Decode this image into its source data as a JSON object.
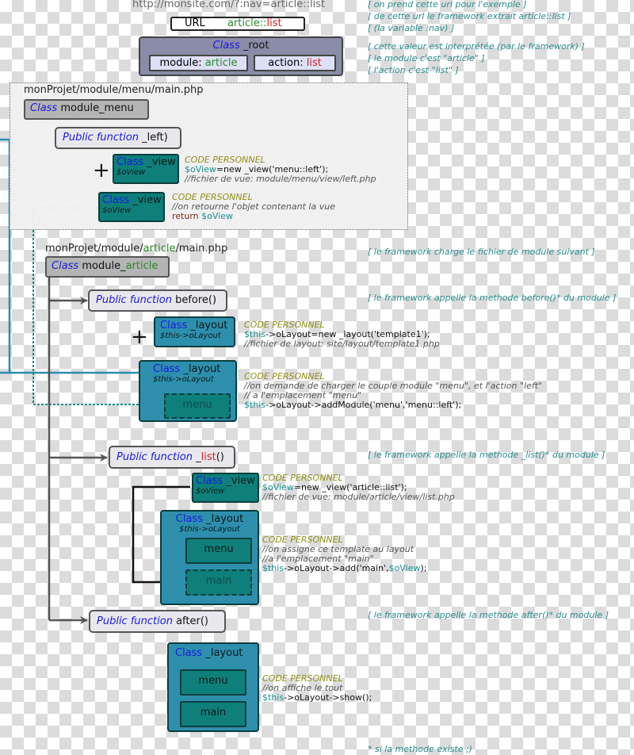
{
  "top": {
    "url_caption": "http://monsite.com/?:nav=article::list",
    "url_label": "URL",
    "url_value_module": "article",
    "url_value_sep": "::",
    "url_value_action": "list"
  },
  "root": {
    "class_kw": "Class",
    "class_name": "_root",
    "module_label": "module: ",
    "module_value": "article",
    "action_label": "action: ",
    "action_value": "list"
  },
  "notes": {
    "n1": "[ on prend cette url pour l'exemple ]",
    "n2": "[ de cette url le framework extrait article::list ]",
    "n3": "[ (la variable :nav) ]",
    "n4": "[ cette valeur est interprétée (par le framework) ]",
    "n5": "[ le module c'est \"article\" ]",
    "n6": "[ l'action c'est \"list\" ]",
    "n7": "[ le framework charge le fichier de module suivant ]",
    "n8": "[ le framework appelle la methode before()* du module ]",
    "n9": "[ le framework appelle la methode _list()* du module ]",
    "n10": "[ le framework appelle la methode after()* du module ]",
    "footnote": "* si la methode existe ;)"
  },
  "menu_module": {
    "path": "monProjet/module/menu/main.php",
    "class_kw": "Class",
    "class_name": "module_menu",
    "fn_kw": "Public function",
    "fn_name": "_left)",
    "view1": {
      "kw": "Class",
      "name": "_view",
      "var": "$oView"
    },
    "code1": {
      "title": "CODE PERSONNEL",
      "line1_var": "$oView",
      "line1_rest": "=new _view('menu::left');",
      "line2": "//fichier de vue: module/menu/view/left.php"
    },
    "view2": {
      "kw": "Class",
      "name": "_view",
      "var": "$oView"
    },
    "code2": {
      "title": "CODE PERSONNEL",
      "line1": "//on retourne l'objet contenant la vue",
      "line2_kw": "return ",
      "line2_var": "$oView"
    }
  },
  "article_module": {
    "path_a": "monProjet/module/",
    "path_b": "article",
    "path_c": "/main.php",
    "class_kw": "Class",
    "class_name_a": "module_",
    "class_name_b": "article",
    "before": {
      "fn_kw": "Public function",
      "fn_name": "before()",
      "layout1": {
        "kw": "Class",
        "name": "_layout",
        "var": "$this->oLayout"
      },
      "code1": {
        "title": "CODE PERSONNEL",
        "var": "$this",
        "rest": "->oLayout=new _layout('template1');",
        "comment": "//fichier de layout: site/layout/template1.php"
      },
      "layout2": {
        "kw": "Class",
        "name": "_layout",
        "var": "$this->oLayout",
        "slot": "menu"
      },
      "code2": {
        "title": "CODE PERSONNEL",
        "comment1": "//on demande de charger le couple module \"menu\", et l'action \"left\"",
        "comment2": "// a l'emplacement \"menu\"",
        "var": "$this",
        "rest": "->oLayout->addModule('menu','menu::left');"
      }
    },
    "list": {
      "fn_kw": "Public function",
      "fn_name_a": "_",
      "fn_name_b": "list",
      "fn_name_c": "()",
      "view": {
        "kw": "Class",
        "name": "_view",
        "var": "$oView"
      },
      "code1": {
        "title": "CODE PERSONNEL",
        "var": "$oView",
        "rest": "=new _view('article::list');",
        "comment": "//fichier de vue: module/article/view/list.php"
      },
      "layout": {
        "kw": "Class",
        "name": "_layout",
        "var": "$this->oLayout",
        "slot1": "menu",
        "slot2": "main"
      },
      "code2": {
        "title": "CODE PERSONNEL",
        "comment1": "//on assigne ce template au layout",
        "comment2": "//a l'emplacement \"main\"",
        "var": "$this",
        "rest": "->oLayout->add('main',",
        "var2": "$oView",
        "end": ");"
      }
    },
    "after": {
      "fn_kw": "Public function",
      "fn_name": "after()",
      "layout": {
        "kw": "Class",
        "name": "_layout",
        "slot1": "menu",
        "slot2": "main"
      },
      "code": {
        "title": "CODE PERSONNEL",
        "comment": "//on affiche le tout",
        "var": "$this",
        "rest": "->oLayout->show();"
      }
    }
  }
}
